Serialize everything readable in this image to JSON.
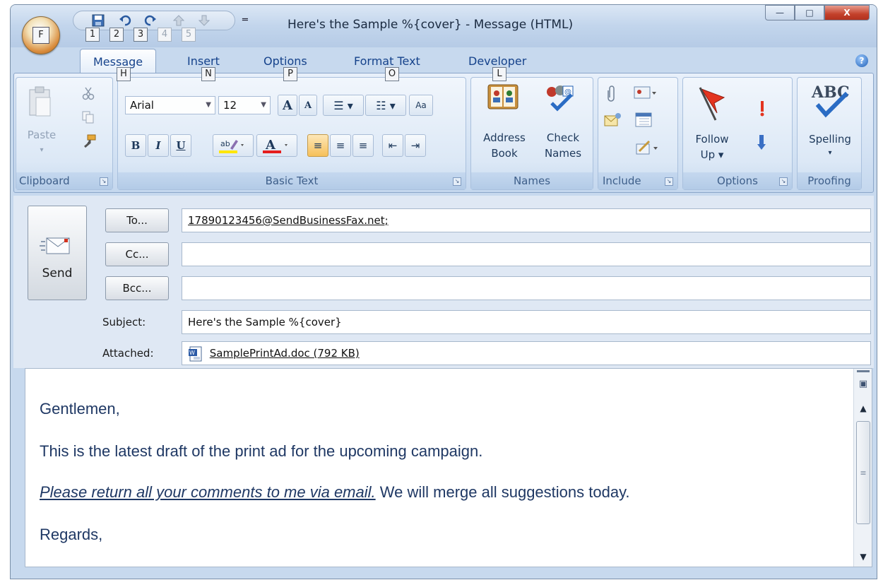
{
  "window": {
    "title": "Here's the Sample %{cover} - Message (HTML)",
    "office_keytip": "F",
    "qat_keytips": [
      "1",
      "2",
      "3",
      "4",
      "5"
    ],
    "qat_dropdown": "═",
    "controls": {
      "minimize": "—",
      "maximize": "□",
      "close": "X"
    }
  },
  "tabs": [
    {
      "label": "Message",
      "keytip": "H",
      "active": true
    },
    {
      "label": "Insert",
      "keytip": "N"
    },
    {
      "label": "Options",
      "keytip": "P"
    },
    {
      "label": "Format Text",
      "keytip": "O"
    },
    {
      "label": "Developer",
      "keytip": "L"
    }
  ],
  "help": "?",
  "ribbon": {
    "clipboard": {
      "label": "Clipboard",
      "paste": "Paste"
    },
    "basic_text": {
      "label": "Basic Text",
      "font": "Arial",
      "size": "12",
      "bold": "B",
      "italic": "I",
      "underline": "U",
      "grow": "A",
      "shrink": "A",
      "font_color": "A"
    },
    "names": {
      "label": "Names",
      "address_book_1": "Address",
      "address_book_2": "Book",
      "check_names_1": "Check",
      "check_names_2": "Names"
    },
    "include": {
      "label": "Include"
    },
    "options": {
      "label": "Options",
      "follow_up_1": "Follow",
      "follow_up_2": "Up ▾"
    },
    "proofing": {
      "label": "Proofing",
      "spelling": "Spelling",
      "abc": "ABC"
    }
  },
  "header": {
    "send": "Send",
    "to_button": "To...",
    "cc_button": "Cc...",
    "bcc_button": "Bcc...",
    "to_value": "17890123456@SendBusinessFax.net;",
    "cc_value": "",
    "bcc_value": "",
    "subject_label": "Subject:",
    "subject_value": "Here's the Sample %{cover}",
    "attached_label": "Attached:",
    "attachment": "SamplePrintAd.doc (792 KB)"
  },
  "body": {
    "greeting": "Gentlemen,",
    "line1": "This is the latest draft of the print ad for the upcoming campaign.",
    "line2_emphasis": "Please return all your comments to me via email.",
    "line2_rest": " We will merge all suggestions today.",
    "closing": "Regards,"
  },
  "colors": {
    "ribbon_bg": "#d2e1f3",
    "body_text": "#1f3864",
    "close_button": "#c3412b"
  }
}
